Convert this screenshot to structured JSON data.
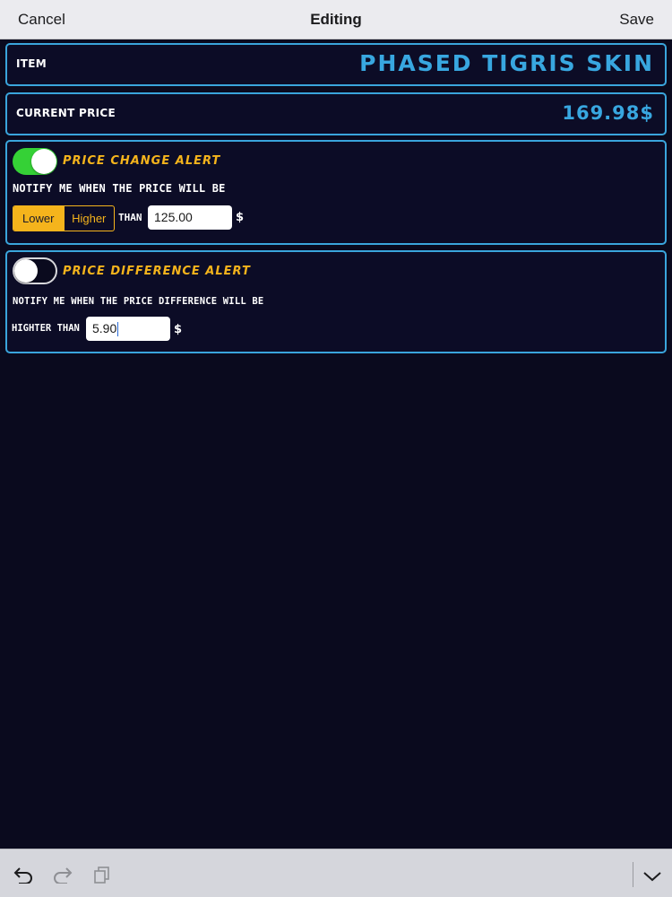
{
  "navbar": {
    "cancel_label": "Cancel",
    "title": "Editing",
    "save_label": "Save"
  },
  "item": {
    "label": "ITEM",
    "value": "PHASED TIGRIS SKIN"
  },
  "current_price": {
    "label": "CURRENT PRICE",
    "value": "169.98$"
  },
  "price_change_alert": {
    "enabled": true,
    "title": "PRICE CHANGE ALERT",
    "description": "NOTIFY ME WHEN THE PRICE WILL BE",
    "segment": {
      "options": [
        "Lower",
        "Higher"
      ],
      "selected": "Lower"
    },
    "than_label": "THAN",
    "value": "125.00",
    "currency": "$"
  },
  "price_difference_alert": {
    "enabled": false,
    "title": "PRICE DIFFERENCE ALERT",
    "description": "NOTIFY ME WHEN THE PRICE DIFFERENCE WILL BE",
    "higher_than_label": "HIGHTER THAN",
    "value": "5.90",
    "currency": "$"
  },
  "toolbar": {
    "icons": [
      "undo-icon",
      "redo-icon",
      "paste-icon",
      "keyboard-dismiss-icon"
    ]
  },
  "colors": {
    "background": "#0a0a1e",
    "card_border": "#3aa5dc",
    "accent_blue": "#38a7e0",
    "accent_orange": "#f5b41c",
    "toggle_on": "#35d136"
  }
}
